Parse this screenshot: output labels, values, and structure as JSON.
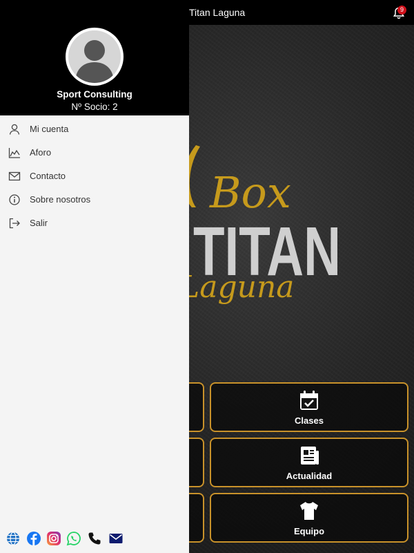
{
  "app": {
    "title": "Titan Laguna",
    "notifications": "9"
  },
  "logo": {
    "line1": "Box",
    "line2": "TITAN",
    "line3": "Laguna"
  },
  "tiles": [
    {
      "label": "Clases",
      "icon": "calendar-check-icon"
    },
    {
      "label": "Actualidad",
      "icon": "newspaper-icon"
    },
    {
      "label": "Equipo",
      "icon": "tshirt-icon"
    }
  ],
  "drawer": {
    "user": {
      "name": "Sport Consulting",
      "member": "Nº Socio: 2"
    },
    "menu": [
      {
        "label": "Mi cuenta",
        "icon": "person-icon"
      },
      {
        "label": "Aforo",
        "icon": "area-chart-icon"
      },
      {
        "label": "Contacto",
        "icon": "envelope-icon"
      },
      {
        "label": "Sobre nosotros",
        "icon": "info-icon"
      },
      {
        "label": "Salir",
        "icon": "logout-icon"
      }
    ],
    "social": [
      "globe-icon",
      "facebook-icon",
      "instagram-icon",
      "whatsapp-icon",
      "phone-icon",
      "mail-icon"
    ]
  },
  "colors": {
    "accent": "#c9922a",
    "logo_gold": "#c69a1c",
    "logo_gray": "#cfcfcf",
    "drawer_bg": "#f4f4f4",
    "badge": "#d0101a"
  }
}
